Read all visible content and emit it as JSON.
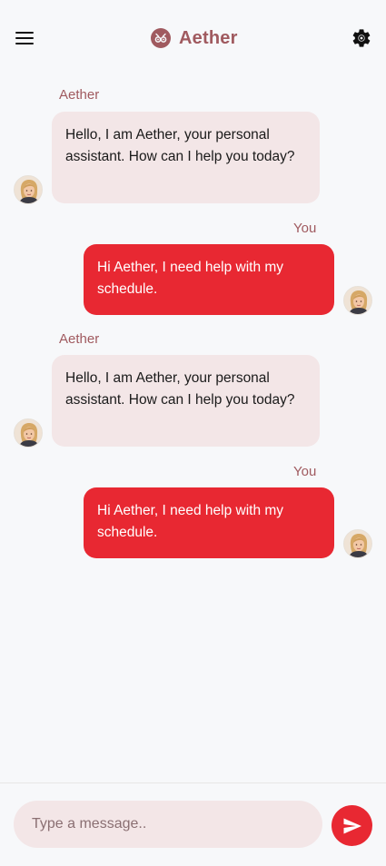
{
  "header": {
    "app_name": "Aether",
    "icons": {
      "menu": "menu-icon",
      "logo": "aether-logo-icon",
      "settings": "gear-icon"
    }
  },
  "messages": [
    {
      "sender": "Aether",
      "type": "bot",
      "text": "Hello, I am Aether, your personal assistant. How can I help you today?"
    },
    {
      "sender": "You",
      "type": "user",
      "text": "Hi Aether, I need help with my schedule."
    },
    {
      "sender": "Aether",
      "type": "bot",
      "text": "Hello, I am Aether, your personal assistant. How can I help you today?"
    },
    {
      "sender": "You",
      "type": "user",
      "text": "Hi Aether, I need help with my schedule."
    }
  ],
  "composer": {
    "placeholder": "Type a message..",
    "send_icon": "send-icon"
  },
  "colors": {
    "accent": "#e82832",
    "brand_text": "#a05a5f",
    "bot_bubble": "#f3e6e7",
    "background": "#f7f8fa"
  }
}
